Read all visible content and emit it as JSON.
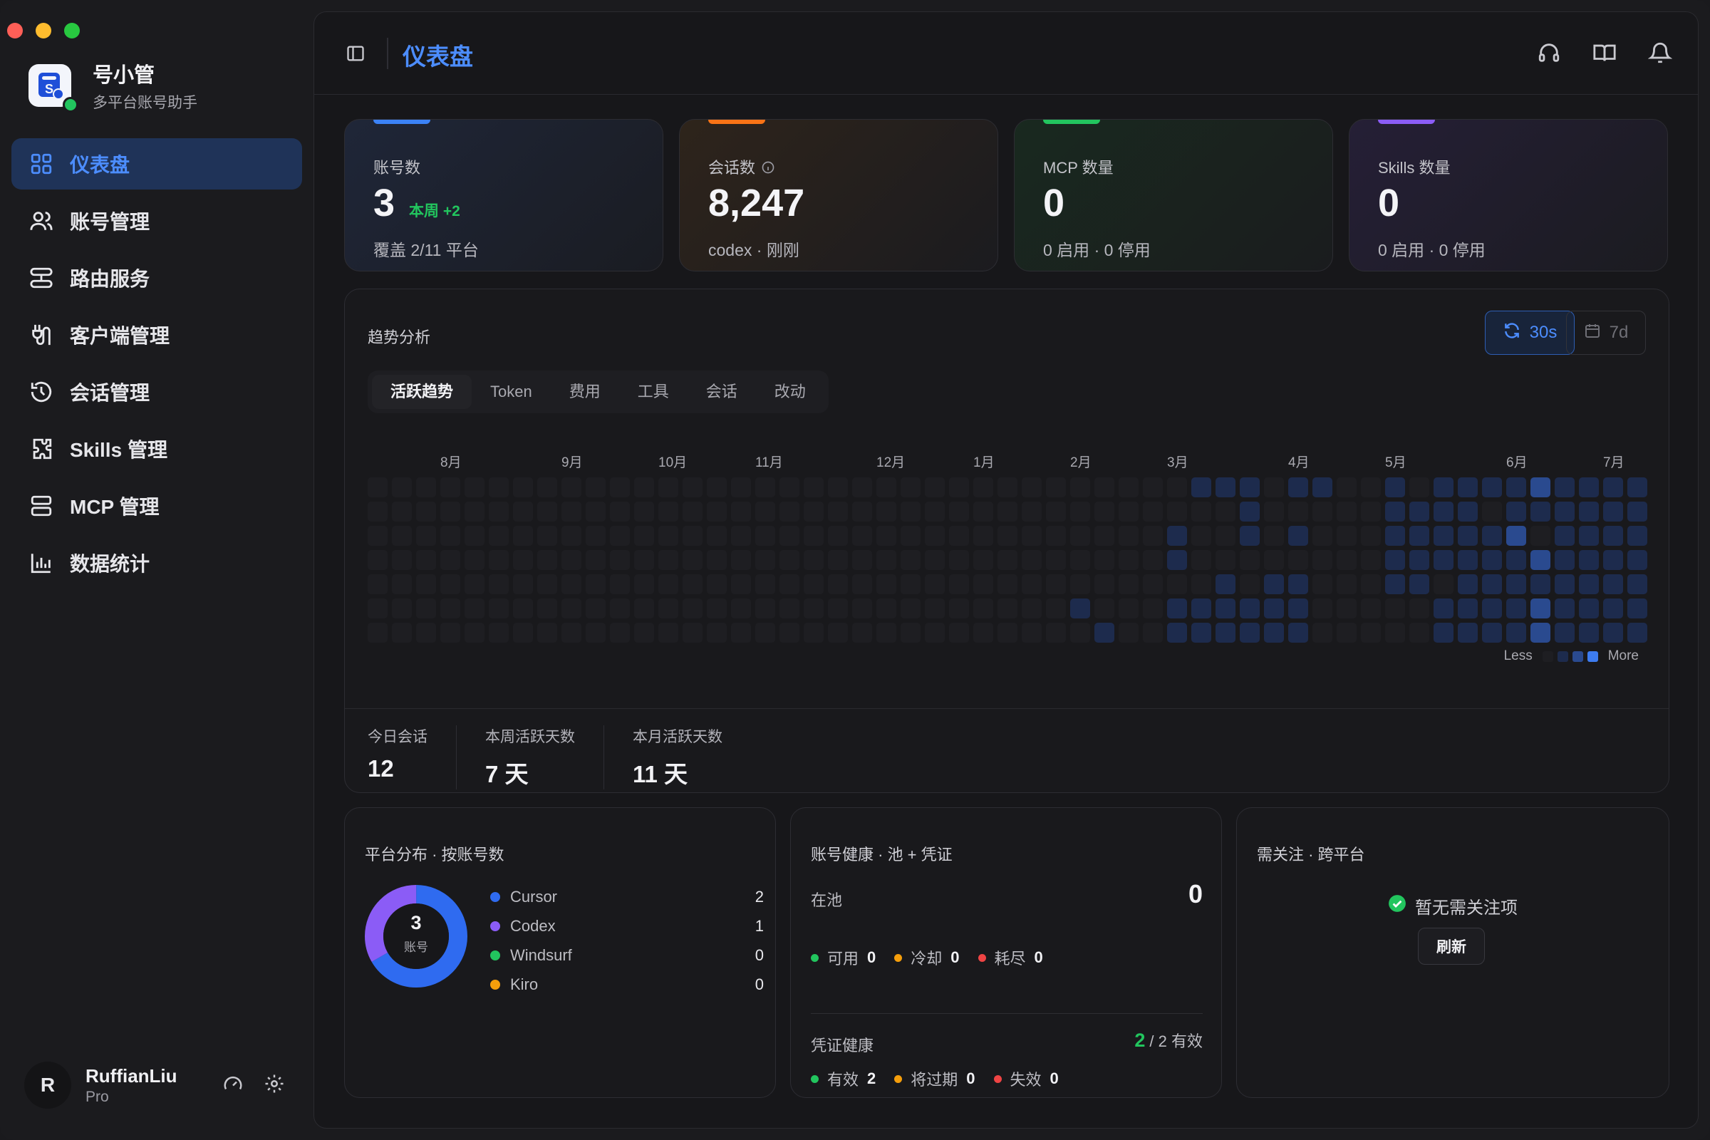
{
  "app": {
    "name": "号小管",
    "subtitle": "多平台账号助手"
  },
  "nav": [
    {
      "id": "dashboard",
      "label": "仪表盘",
      "icon": "grid-icon",
      "active": true
    },
    {
      "id": "accounts",
      "label": "账号管理",
      "icon": "users-icon"
    },
    {
      "id": "routing",
      "label": "路由服务",
      "icon": "route-icon"
    },
    {
      "id": "clients",
      "label": "客户端管理",
      "icon": "plug-icon"
    },
    {
      "id": "sessions",
      "label": "会话管理",
      "icon": "history-icon"
    },
    {
      "id": "skills",
      "label": "Skills 管理",
      "icon": "puzzle-icon"
    },
    {
      "id": "mcp",
      "label": "MCP 管理",
      "icon": "server-icon"
    },
    {
      "id": "stats",
      "label": "数据统计",
      "icon": "bar-chart-icon"
    }
  ],
  "user": {
    "initial": "R",
    "name": "RuffianLiu",
    "plan": "Pro"
  },
  "header": {
    "title": "仪表盘"
  },
  "cards": {
    "accounts": {
      "label": "账号数",
      "value": "3",
      "delta": "本周 +2",
      "foot": "覆盖 2/11 平台"
    },
    "sessions": {
      "label": "会话数",
      "value": "8,247",
      "foot": "codex · 刚刚"
    },
    "mcp": {
      "label": "MCP 数量",
      "value": "0",
      "foot": "0 启用 · 0 停用"
    },
    "skills": {
      "label": "Skills 数量",
      "value": "0",
      "foot": "0 启用 · 0 停用"
    }
  },
  "colors": {
    "blue": "#3b82f6",
    "orange": "#f59e0b",
    "green": "#22c55e",
    "purple": "#8b5cf6",
    "red": "#ef4444"
  },
  "trend": {
    "title": "趋势分析",
    "refresh_label": "30s",
    "range_label": "7d",
    "tabs": [
      "活跃趋势",
      "Token",
      "费用",
      "工具",
      "会话",
      "改动"
    ],
    "months": [
      {
        "label": "8月",
        "week": 3
      },
      {
        "label": "9月",
        "week": 8
      },
      {
        "label": "10月",
        "week": 12
      },
      {
        "label": "11月",
        "week": 16
      },
      {
        "label": "12月",
        "week": 21
      },
      {
        "label": "1月",
        "week": 25
      },
      {
        "label": "2月",
        "week": 29
      },
      {
        "label": "3月",
        "week": 33
      },
      {
        "label": "4月",
        "week": 38
      },
      {
        "label": "5月",
        "week": 42
      },
      {
        "label": "6月",
        "week": 47
      },
      {
        "label": "7月",
        "week": 51
      }
    ],
    "activity_start_week": 28,
    "activity": [
      "0000000,0000010,0000001,0000000,0000000,0011011,1000011",
      "1000111,1110011,0000111,1010111,1000000,0000000,0000000",
      "1111100,0111100,1111011,1111111,1011111,1121111,2102122",
      "1111111,1111111,1111111,1111111,1111111,1111111,1101111",
      "1000000"
    ],
    "legend_less": "Less",
    "legend_more": "More",
    "kpis": [
      {
        "label": "今日会话",
        "value": "12"
      },
      {
        "label": "本周活跃天数",
        "value": "7 天"
      },
      {
        "label": "本月活跃天数",
        "value": "11 天"
      }
    ]
  },
  "platform": {
    "title": "平台分布 · 按账号数",
    "total": "3",
    "total_label": "账号",
    "items": [
      {
        "name": "Cursor",
        "count": 2,
        "color": "#2f6bf0"
      },
      {
        "name": "Codex",
        "count": 1,
        "color": "#8b5cf6"
      },
      {
        "name": "Windsurf",
        "count": 0,
        "color": "#22c55e"
      },
      {
        "name": "Kiro",
        "count": 0,
        "color": "#f59e0b"
      }
    ]
  },
  "health": {
    "title": "账号健康 · 池 + 凭证",
    "pool_label": "在池",
    "pool_value": "0",
    "pool_items": [
      {
        "label": "可用",
        "value": "0",
        "color": "#22c55e"
      },
      {
        "label": "冷却",
        "value": "0",
        "color": "#f59e0b"
      },
      {
        "label": "耗尽",
        "value": "0",
        "color": "#ef4444"
      }
    ],
    "cred_label": "凭证健康",
    "cred_ok": "2",
    "cred_rest": "/ 2 有效",
    "cred_items": [
      {
        "label": "有效",
        "value": "2",
        "color": "#22c55e"
      },
      {
        "label": "将过期",
        "value": "0",
        "color": "#f59e0b"
      },
      {
        "label": "失效",
        "value": "0",
        "color": "#ef4444"
      }
    ]
  },
  "attention": {
    "title": "需关注 · 跨平台",
    "empty_text": "暂无需关注项",
    "refresh_label": "刷新"
  }
}
